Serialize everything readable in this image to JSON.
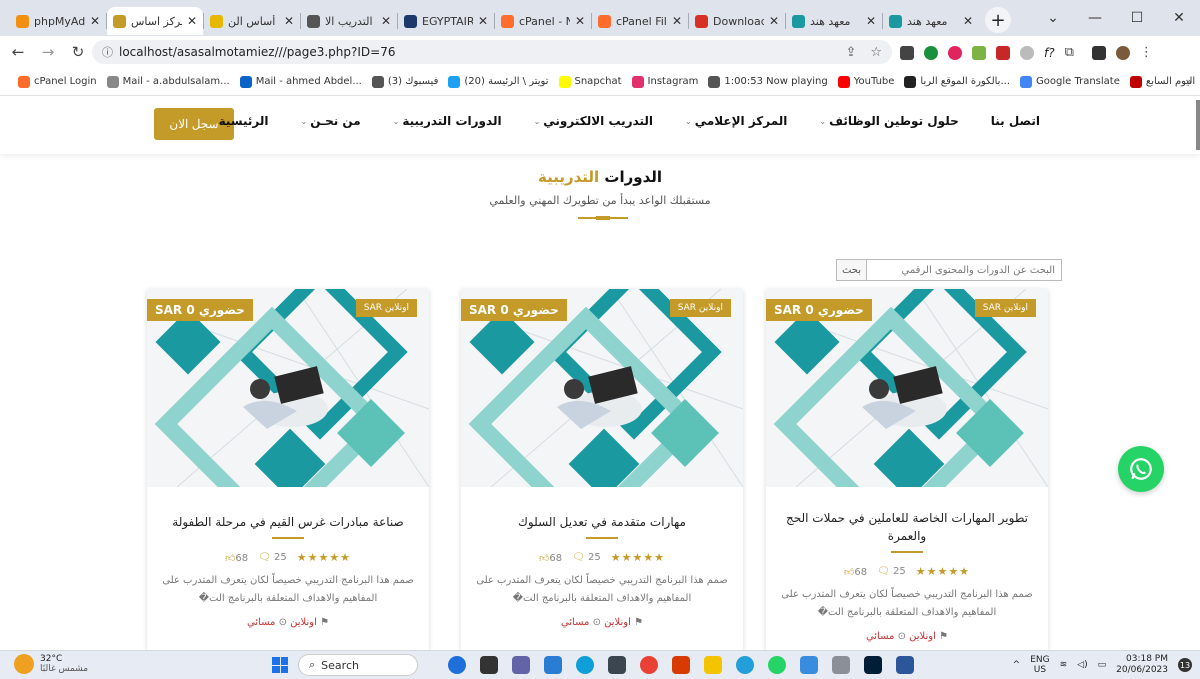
{
  "browser": {
    "tabs": [
      {
        "title": "phpMyAd",
        "color": "#f29111",
        "active": false
      },
      {
        "title": "مركز اساس",
        "color": "#c49a28",
        "active": true
      },
      {
        "title": "أساس الن",
        "color": "#e6b800",
        "active": false
      },
      {
        "title": "التدريب الا",
        "color": "#555555",
        "active": false
      },
      {
        "title": "EGYPTAIR",
        "color": "#1b3a6b",
        "active": false
      },
      {
        "title": "cPanel - N",
        "color": "#ff6c2c",
        "active": false
      },
      {
        "title": "cPanel Fil",
        "color": "#ff6c2c",
        "active": false
      },
      {
        "title": "Download",
        "color": "#d93025",
        "active": false
      },
      {
        "title": "معهد هند",
        "color": "#1a9aa0",
        "active": false
      },
      {
        "title": "معهد هند",
        "color": "#1a9aa0",
        "active": false
      }
    ],
    "url": "localhost/asasalmotamiez///page3.php?ID=76"
  },
  "bookmarks": [
    {
      "label": "cPanel Login",
      "color": "#ff6c2c"
    },
    {
      "label": "Mail - a.abdulsalam...",
      "color": "#888888"
    },
    {
      "label": "Mail - ahmed Abdel...",
      "color": "#0a64c8"
    },
    {
      "label": "(3) فيسبوك",
      "color": "#555555"
    },
    {
      "label": "(20) تويتر \\ الرئيسة",
      "color": "#1da1f2"
    },
    {
      "label": "Snapchat",
      "color": "#fffc00"
    },
    {
      "label": "Instagram",
      "color": "#e1306c"
    },
    {
      "label": "1:00:53 Now playing",
      "color": "#555555"
    },
    {
      "label": "YouTube",
      "color": "#ff0000"
    },
    {
      "label": "بالكورة الموقع الربا...",
      "color": "#222222"
    },
    {
      "label": "Google Translate",
      "color": "#4285f4"
    },
    {
      "label": "اليوم السابع",
      "color": "#c00000"
    }
  ],
  "site": {
    "register_label": "سجل الان",
    "nav": [
      {
        "label": "الرئيسية",
        "caret": false
      },
      {
        "label": "من نحـن",
        "caret": true
      },
      {
        "label": "الدورات التدريبية",
        "caret": true
      },
      {
        "label": "التدريب الالكتروني",
        "caret": true
      },
      {
        "label": "المركز الإعلامي",
        "caret": true
      },
      {
        "label": "حلول توطين الوظائف",
        "caret": true
      },
      {
        "label": "اتصل بنا",
        "caret": false
      }
    ]
  },
  "section": {
    "title_main": "الدورات",
    "title_accent": "التدريبية",
    "subtitle": "مستقبلك الواعد يبدأ من تطويرك المهني والعلمي"
  },
  "search": {
    "placeholder": "البحث عن الدورات والمحتوى الرقمي",
    "button_label": "بحث"
  },
  "courses": [
    {
      "title": "تطوير المهارات الخاصة للعاملين في حملات الحج والعمرة",
      "price_badge": "حضوري 0 SAR",
      "online_badge": "اونلاين SAR",
      "likes": "68",
      "comments": "25",
      "stars": "★★★★★",
      "description": "صمم هذا البرنامج التدريبي خصيصاً لكان يتعرف المتدرب على المفاهيم والاهداف المتعلقة بالبرنامج الت�",
      "mode": "اونلاين",
      "time": "مسائي"
    },
    {
      "title": "مهارات متقدمة في تعديل السلوك",
      "price_badge": "حضوري 0 SAR",
      "online_badge": "اونلاين SAR",
      "likes": "68",
      "comments": "25",
      "stars": "★★★★★",
      "description": "صمم هذا البرنامج التدريبي خصيصاً لكان يتعرف المتدرب على المفاهيم والاهداف المتعلقة بالبرنامج الت�",
      "mode": "اونلاين",
      "time": "مسائي"
    },
    {
      "title": "صناعة مبادرات غرس القيم في مرحلة الطفولة",
      "price_badge": "حضوري 0 SAR",
      "online_badge": "اونلاين SAR",
      "likes": "68",
      "comments": "25",
      "stars": "★★★★★",
      "description": "صمم هذا البرنامج التدريبي خصيصاً لكان يتعرف المتدرب على المفاهيم والاهداف المتعلقة بالبرنامج الت�",
      "mode": "اونلاين",
      "time": "مسائي"
    }
  ],
  "taskbar": {
    "temp": "32°C",
    "weather": "مشمس غالبًا",
    "search_label": "Search",
    "lang": "ENG",
    "region": "US",
    "time": "03:18 PM",
    "date": "20/06/2023",
    "notif_count": "13"
  }
}
